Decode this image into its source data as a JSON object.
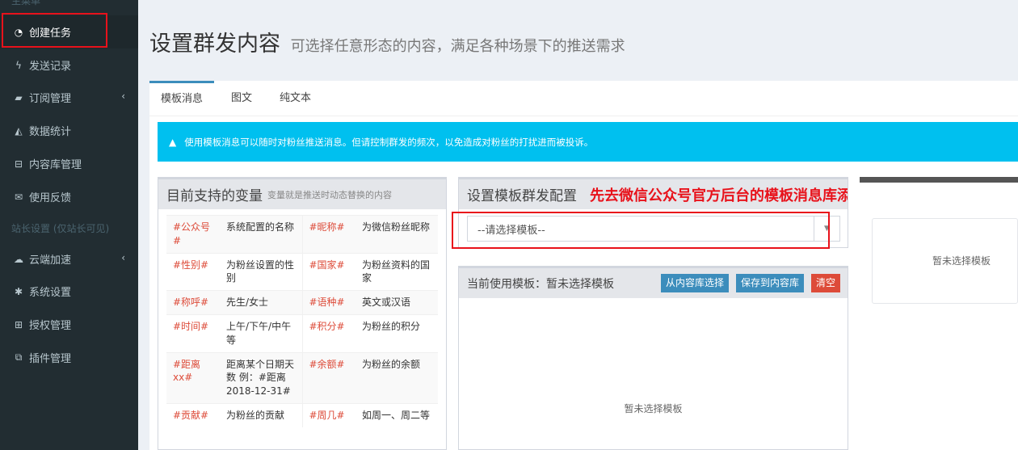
{
  "sidebar": {
    "header": "主菜单",
    "divider": "站长设置 (仅站长可见)",
    "items": [
      {
        "label": "创建任务",
        "icon": "dashboard-icon",
        "glyph": "◔",
        "active": true
      },
      {
        "label": "发送记录",
        "icon": "bolt-icon",
        "glyph": "ϟ"
      },
      {
        "label": "订阅管理",
        "icon": "book-icon",
        "glyph": "▰",
        "chevron": "‹"
      },
      {
        "label": "数据统计",
        "icon": "area-chart-icon",
        "glyph": "◭"
      },
      {
        "label": "内容库管理",
        "icon": "hdd-icon",
        "glyph": "⊟"
      },
      {
        "label": "使用反馈",
        "icon": "envelope-icon",
        "glyph": "✉"
      },
      {
        "label": "云端加速",
        "icon": "cloud-icon",
        "glyph": "☁",
        "chevron": "‹"
      },
      {
        "label": "系统设置",
        "icon": "asterisk-icon",
        "glyph": "✱"
      },
      {
        "label": "授权管理",
        "icon": "cart-icon",
        "glyph": "⊞"
      },
      {
        "label": "插件管理",
        "icon": "puzzle-icon",
        "glyph": "⧉"
      }
    ]
  },
  "page": {
    "title": "设置群发内容",
    "subtitle": "可选择任意形态的内容，满足各种场景下的推送需求"
  },
  "tabs": [
    "模板消息",
    "图文",
    "纯文本"
  ],
  "alert": {
    "icon": "warning-icon",
    "glyph": "▲",
    "text": "使用模板消息可以随时对粉丝推送消息。但请控制群发的频次，以免造成对粉丝的打扰进而被投诉。"
  },
  "variables": {
    "title": "目前支持的变量",
    "subtitle": "变量就是推送时动态替换的内容",
    "rows": [
      [
        {
          "k": "#公众号#",
          "d": "系统配置的名称"
        },
        {
          "k": "#昵称#",
          "d": "为微信粉丝昵称"
        }
      ],
      [
        {
          "k": "#性别#",
          "d": "为粉丝设置的性别"
        },
        {
          "k": "#国家#",
          "d": "为粉丝资料的国家"
        }
      ],
      [
        {
          "k": "#称呼#",
          "d": "先生/女士"
        },
        {
          "k": "#语种#",
          "d": "英文或汉语"
        }
      ],
      [
        {
          "k": "#时间#",
          "d": "上午/下午/中午等"
        },
        {
          "k": "#积分#",
          "d": "为粉丝的积分"
        }
      ],
      [
        {
          "k": "#距离xx#",
          "d": "距离某个日期天数 例：#距离2018-12-31#"
        },
        {
          "k": "#余额#",
          "d": "为粉丝的余额"
        }
      ],
      [
        {
          "k": "#贡献#",
          "d": "为粉丝的贡献"
        },
        {
          "k": "#周几#",
          "d": "如周一、周二等"
        }
      ]
    ]
  },
  "config": {
    "title": "设置模板群发配置",
    "note": "先去微信公众号官方后台的模板消息库添加合适的模板",
    "select_value": "--请选择模板--",
    "arrow": "▼"
  },
  "current": {
    "title": "当前使用模板：暂未选择模板",
    "btn_from_library": "从内容库选择",
    "btn_save": "保存到内容库",
    "btn_clear": "清空",
    "empty": "暂未选择模板"
  },
  "preview": {
    "empty": "暂未选择模板"
  }
}
